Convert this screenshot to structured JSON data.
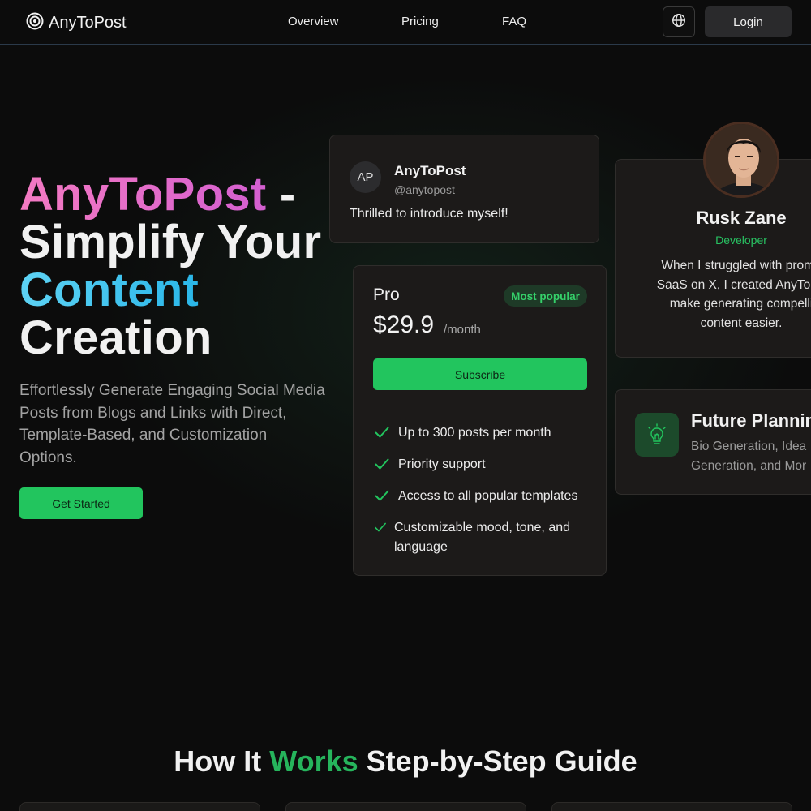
{
  "nav": {
    "brand": "AnyToPost",
    "links": [
      "Overview",
      "Pricing",
      "FAQ"
    ],
    "login": "Login",
    "language_icon": "globe-icon",
    "brand_icon": "target-icon"
  },
  "hero": {
    "title_part1": "AnyToPost",
    "title_part2": " - Simplify Your ",
    "title_part3": "Content",
    "title_part4": " Creation",
    "subtitle": "Effortlessly Generate Engaging Social Media Posts from Blogs and Links with Direct, Template-Based, and Customization Options.",
    "cta": "Get Started"
  },
  "post_card": {
    "avatar_initials": "AP",
    "name": "AnyToPost",
    "handle": "@anytopost",
    "text": "Thrilled to introduce myself!"
  },
  "pricing": {
    "plan": "Pro",
    "badge": "Most popular",
    "price": "$29.9",
    "period": "/month",
    "subscribe": "Subscribe",
    "features": [
      "Up to 300 posts per month",
      "Priority support",
      "Access to all popular templates",
      "Customizable mood, tone, and",
      "language"
    ]
  },
  "testimonial": {
    "name": "Rusk Zane",
    "role": "Developer",
    "quote_lines": [
      "When I struggled with promo",
      "SaaS on X, I created AnyToPo",
      "make generating compelli",
      "content easier."
    ]
  },
  "future": {
    "title": "Future Planning",
    "desc_lines": [
      "Bio Generation, Idea",
      "Generation, and Mor"
    ]
  },
  "how": {
    "title_a": "How It ",
    "title_b": "Works",
    "title_c": " Step-by-Step Guide"
  },
  "colors": {
    "accent_green": "#22c55e",
    "pink": "#e46ec8",
    "blue": "#3cc4ee",
    "background": "#0c0c0c"
  }
}
